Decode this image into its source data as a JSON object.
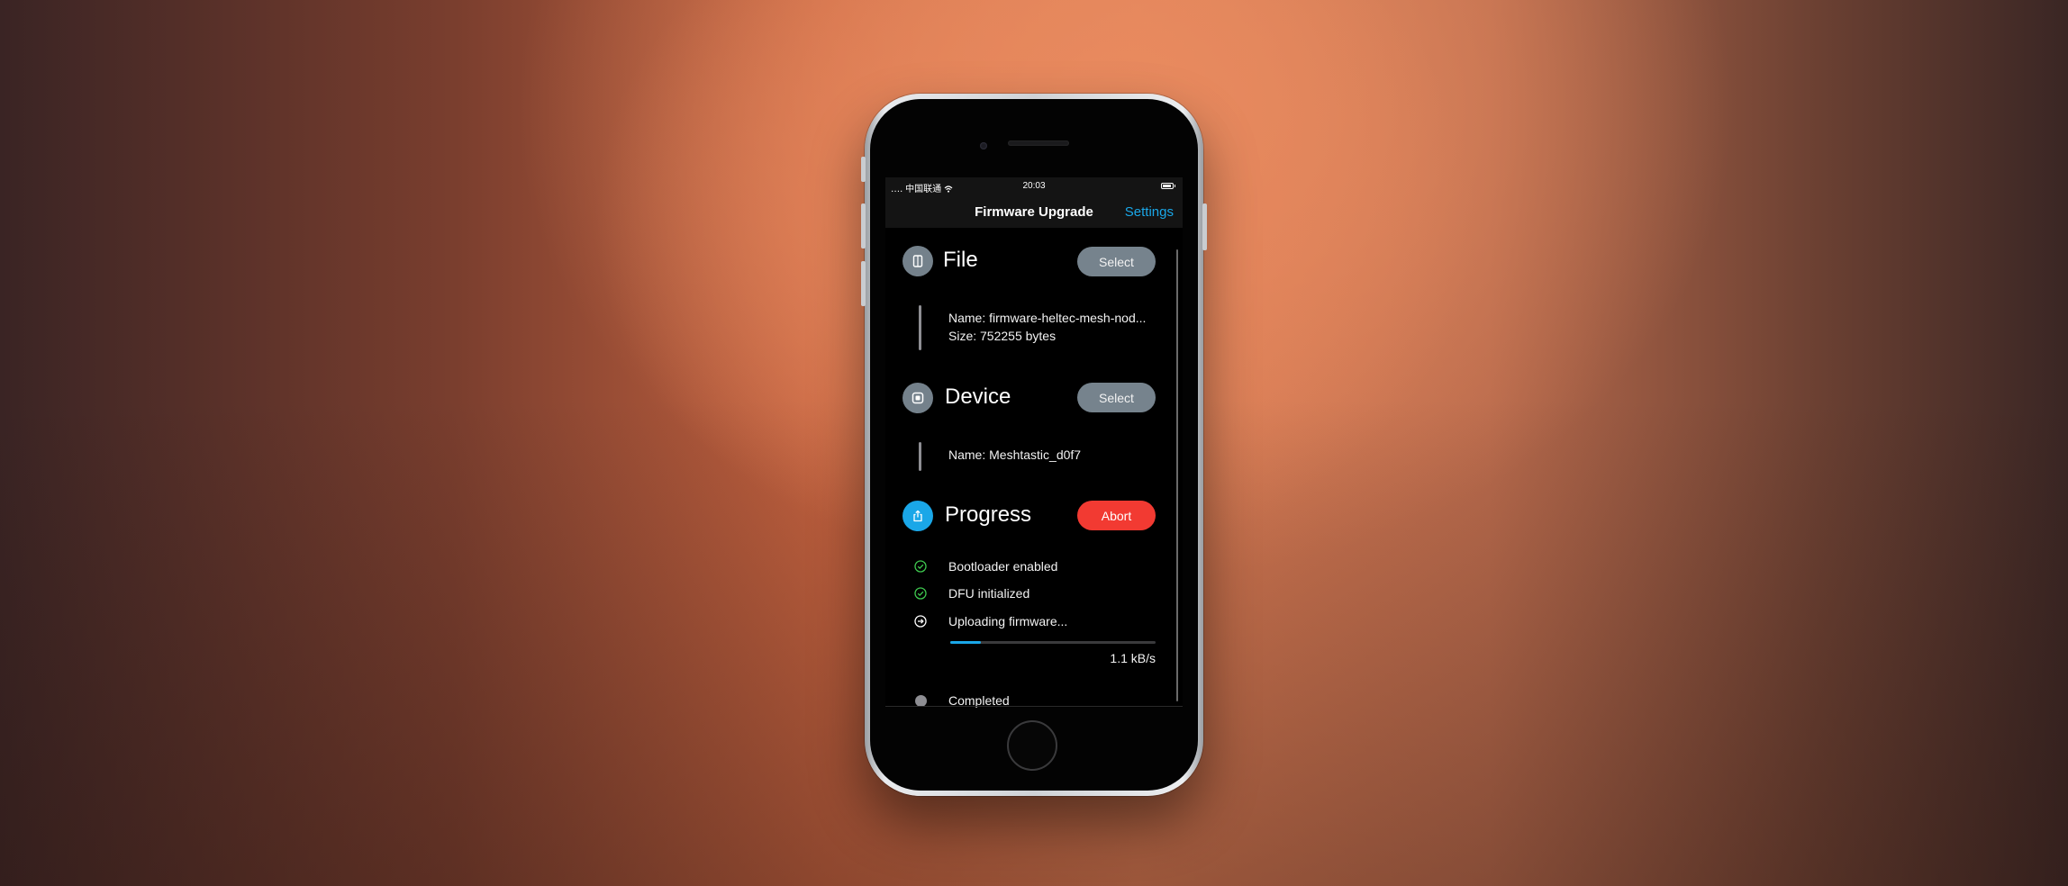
{
  "status_bar": {
    "carrier": "․․․․ 中国联通",
    "time": "20:03"
  },
  "nav": {
    "title": "Firmware Upgrade",
    "settings_label": "Settings"
  },
  "file": {
    "title": "File",
    "select_label": "Select",
    "name_line": "Name: firmware-heltec-mesh-nod...",
    "size_line": "Size: 752255 bytes"
  },
  "device": {
    "title": "Device",
    "select_label": "Select",
    "name_line": "Name: Meshtastic_d0f7"
  },
  "progress": {
    "title": "Progress",
    "abort_label": "Abort",
    "steps": [
      {
        "label": "Bootloader enabled",
        "state": "done"
      },
      {
        "label": "DFU initialized",
        "state": "done"
      },
      {
        "label": "Uploading firmware...",
        "state": "in-progress"
      },
      {
        "label": "Completed",
        "state": "pending"
      }
    ],
    "upload_fraction": 0.15,
    "speed": "1.1 kB/s"
  },
  "colors": {
    "accent": "#1aa7e8",
    "success": "#3ec94f",
    "danger": "#f23a32",
    "section_icon": "#74818b"
  },
  "icons": {
    "file": "file-icon",
    "device": "chip-icon",
    "progress": "share-upload-icon",
    "done": "checkmark-circle-icon",
    "in_progress": "arrow-right-circle-icon",
    "pending": "dot-icon"
  }
}
